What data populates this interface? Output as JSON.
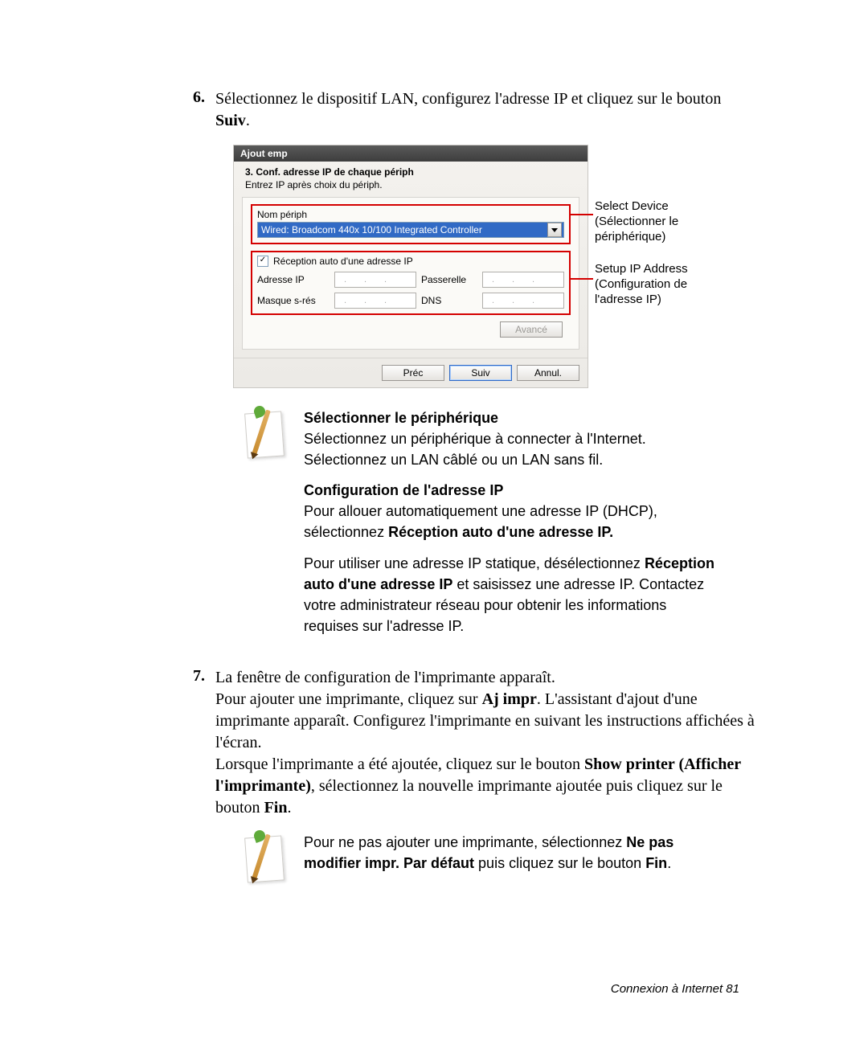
{
  "step6": {
    "num": "6.",
    "text_a": "Sélectionnez le dispositif LAN, configurez l'adresse IP et cliquez sur le bouton ",
    "suiv": "Suiv",
    "dot": "."
  },
  "dialog": {
    "title": "Ajout emp",
    "header": "3. Conf. adresse IP de chaque périph",
    "sub": "Entrez IP après choix du périph.",
    "device_label": "Nom périph",
    "device_value": "Wired: Broadcom 440x 10/100 Integrated Controller",
    "chk_label": "Réception auto d'une adresse IP",
    "ip_label": "Adresse IP",
    "gw_label": "Passerelle",
    "mask_label": "Masque s-rés",
    "dns_label": "DNS",
    "btn_adv": "Avancé",
    "btn_prev": "Préc",
    "btn_next": "Suiv",
    "btn_cancel": "Annul."
  },
  "callouts": {
    "c1": "Select Device (Sélectionner le périphérique)",
    "c2": "Setup IP Address (Configuration de l'adresse IP)"
  },
  "note1": {
    "h1": "Sélectionner le périphérique",
    "p1": "Sélectionnez un périphérique à connecter à l'Internet. Sélectionnez un LAN câblé ou un LAN sans fil.",
    "h2": "Configuration de l'adresse IP",
    "p2a": "Pour allouer automatiquement une adresse IP (DHCP), sélectionnez ",
    "p2b": "Réception auto d'une adresse IP.",
    "p3a": "Pour utiliser une adresse IP statique, désélectionnez ",
    "p3b": "Réception auto d'une adresse IP",
    "p3c": " et saisissez une adresse IP. Contactez votre administrateur réseau pour obtenir les informations requises sur l'adresse IP."
  },
  "step7": {
    "num": "7.",
    "l1": "La fenêtre de configuration de l'imprimante apparaît.",
    "l2a": "Pour ajouter une imprimante, cliquez sur ",
    "l2b": "Aj impr",
    "l2c": ". L'assistant d'ajout d'une imprimante apparaît. Configurez l'imprimante en suivant les instructions affichées à l'écran.",
    "l3a": "Lorsque l'imprimante a été ajoutée, cliquez sur le bouton ",
    "l3b": "Show printer (Afficher l'imprimante)",
    "l3c": ", sélectionnez la nouvelle imprimante ajoutée puis cliquez sur le bouton ",
    "l3d": "Fin",
    "l3e": "."
  },
  "note2": {
    "t1": "Pour ne pas ajouter une imprimante, sélectionnez ",
    "t2": "Ne pas modifier impr. Par défaut",
    "t3": " puis cliquez sur le bouton ",
    "t4": "Fin",
    "t5": "."
  },
  "footer": "Connexion à Internet  81"
}
